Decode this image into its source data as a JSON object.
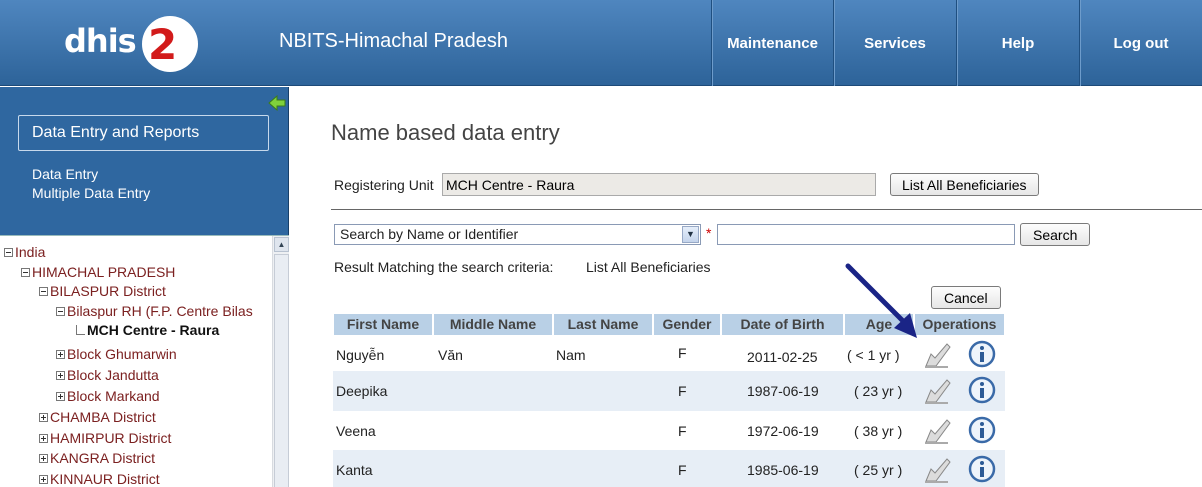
{
  "header": {
    "logo_text": "dhis2",
    "site_title": "NBITS-Himachal Pradesh",
    "nav": [
      "Maintenance",
      "Services",
      "Help",
      "Log out"
    ]
  },
  "sidebar": {
    "module": "Data Entry and Reports",
    "links": [
      "Data Entry",
      "Multiple Data Entry"
    ]
  },
  "tree": {
    "nodes": [
      "India",
      "HIMACHAL PRADESH",
      "BILASPUR District",
      "Bilaspur RH (F.P. Centre Bilas",
      "MCH Centre - Raura",
      "Block Ghumarwin",
      "Block Jandutta",
      "Block Markand",
      "CHAMBA District",
      "HAMIRPUR District",
      "KANGRA District",
      "KINNAUR District"
    ]
  },
  "main": {
    "title": "Name based data entry",
    "registering_label": "Registering Unit",
    "registering_value": "MCH Centre - Raura",
    "list_all_button": "List All Beneficiaries",
    "search_select": "Search by Name or Identifier",
    "required_mark": "*",
    "search_value": "",
    "search_button": "Search",
    "result_label": "Result Matching the search criteria:",
    "result_value": "List All Beneficiaries",
    "cancel_button": "Cancel"
  },
  "table": {
    "columns": [
      "First Name",
      "Middle Name",
      "Last Name",
      "Gender",
      "Date of Birth",
      "Age",
      "Operations"
    ],
    "rows": [
      [
        "Nguyễn",
        "Văn",
        "Nam",
        "F",
        "2011-02-25",
        "( < 1 yr )"
      ],
      [
        "Deepika",
        "",
        "",
        "F",
        "1987-06-19",
        "( 23 yr )"
      ],
      [
        "Veena",
        "",
        "",
        "F",
        "1972-06-19",
        "( 38 yr )"
      ],
      [
        "Kanta",
        "",
        "",
        "F",
        "1985-06-19",
        "( 25 yr )"
      ]
    ]
  },
  "colors": {
    "header": "#2d6399",
    "sidebar": "#2f67a0",
    "table_header": "#b9d0e6",
    "arrow": "#1a2486"
  },
  "icons": [
    "collapse-arrow-icon",
    "edit-record-icon",
    "info-icon",
    "pointer-arrow"
  ]
}
